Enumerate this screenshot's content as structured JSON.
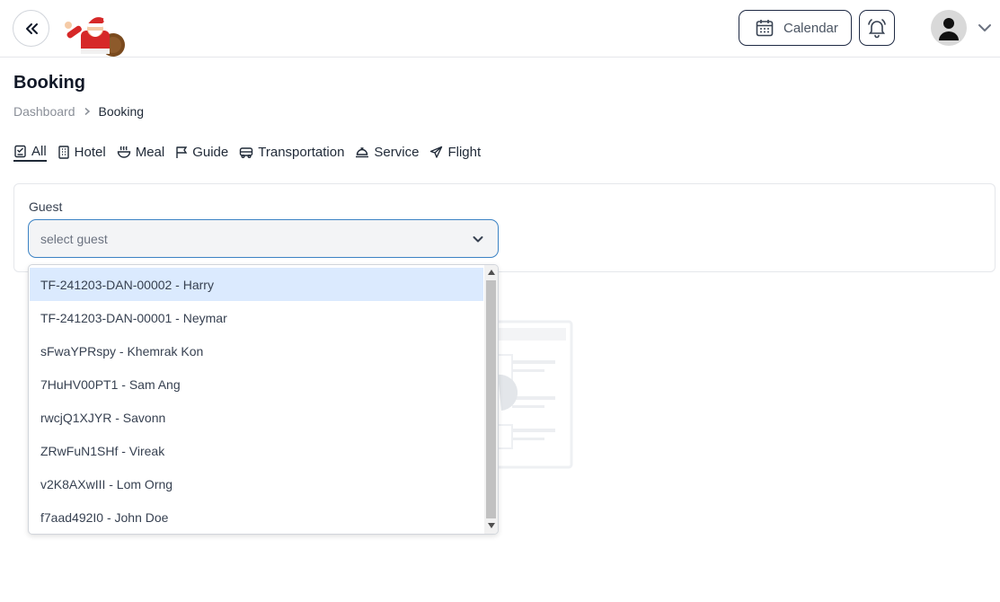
{
  "header": {
    "calendar_label": "Calendar",
    "icons": {
      "back": "double-chevron-left-icon",
      "calendar": "calendar-icon",
      "bell": "bell-icon",
      "avatar": "user-icon",
      "chevron": "chevron-down-icon"
    }
  },
  "page": {
    "title": "Booking",
    "breadcrumb": {
      "parent": "Dashboard",
      "current": "Booking"
    }
  },
  "tabs": [
    {
      "label": "All",
      "icon": "checklist-icon",
      "active": true
    },
    {
      "label": "Hotel",
      "icon": "building-icon"
    },
    {
      "label": "Meal",
      "icon": "bowl-icon"
    },
    {
      "label": "Guide",
      "icon": "flag-icon"
    },
    {
      "label": "Transportation",
      "icon": "bus-icon"
    },
    {
      "label": "Service",
      "icon": "concierge-icon"
    },
    {
      "label": "Flight",
      "icon": "plane-icon"
    }
  ],
  "form": {
    "guest_label": "Guest",
    "guest_placeholder": "select guest"
  },
  "dropdown": {
    "options": [
      "TF-241203-DAN-00002 - Harry",
      "TF-241203-DAN-00001 - Neymar",
      "sFwaYPRspy - Khemrak Kon",
      "7HuHV00PT1 - Sam Ang",
      "rwcjQ1XJYR - Savonn",
      "ZRwFuN1SHf - Vireak",
      "v2K8AXwIII - Lom Orng",
      "f7aad492I0 - John Doe"
    ],
    "highlighted_index": 0
  },
  "colors": {
    "accent": "#3b82c4",
    "highlight": "#dbeafe",
    "border_dark": "#1f2a44"
  }
}
